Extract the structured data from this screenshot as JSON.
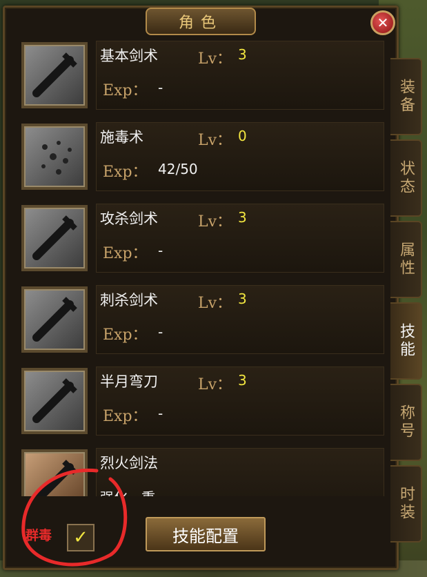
{
  "window": {
    "title": "角色",
    "close_icon": "✕"
  },
  "skills": [
    {
      "name": "基本剑术",
      "lv_label": "Lv：",
      "lv": "3",
      "exp_label": "Exp：",
      "exp": "-",
      "icon": "sword-icon"
    },
    {
      "name": "施毒术",
      "lv_label": "Lv：",
      "lv": "0",
      "exp_label": "Exp：",
      "exp": "42/50",
      "icon": "poison-icon"
    },
    {
      "name": "攻杀剑术",
      "lv_label": "Lv：",
      "lv": "3",
      "exp_label": "Exp：",
      "exp": "-",
      "icon": "sword-icon"
    },
    {
      "name": "刺杀剑术",
      "lv_label": "Lv：",
      "lv": "3",
      "exp_label": "Exp：",
      "exp": "-",
      "icon": "sword-icon"
    },
    {
      "name": "半月弯刀",
      "lv_label": "Lv：",
      "lv": "3",
      "exp_label": "Exp：",
      "exp": "-",
      "icon": "sword-icon"
    },
    {
      "name": "烈火剑法",
      "lv_label": "",
      "lv": "",
      "exp_label": "",
      "exp": "强化一重",
      "icon": "fire-sword-icon"
    }
  ],
  "tabs": [
    "装备",
    "状态",
    "属性",
    "技能",
    "称号",
    "时装"
  ],
  "active_tab": "技能",
  "bottom": {
    "poison_label": "群毒",
    "checkbox_mark": "✓",
    "config_button": "技能配置"
  },
  "colors": {
    "accent_gold": "#c8a36a",
    "level_yellow": "#f2e640",
    "annotation_red": "#e82a2a"
  }
}
